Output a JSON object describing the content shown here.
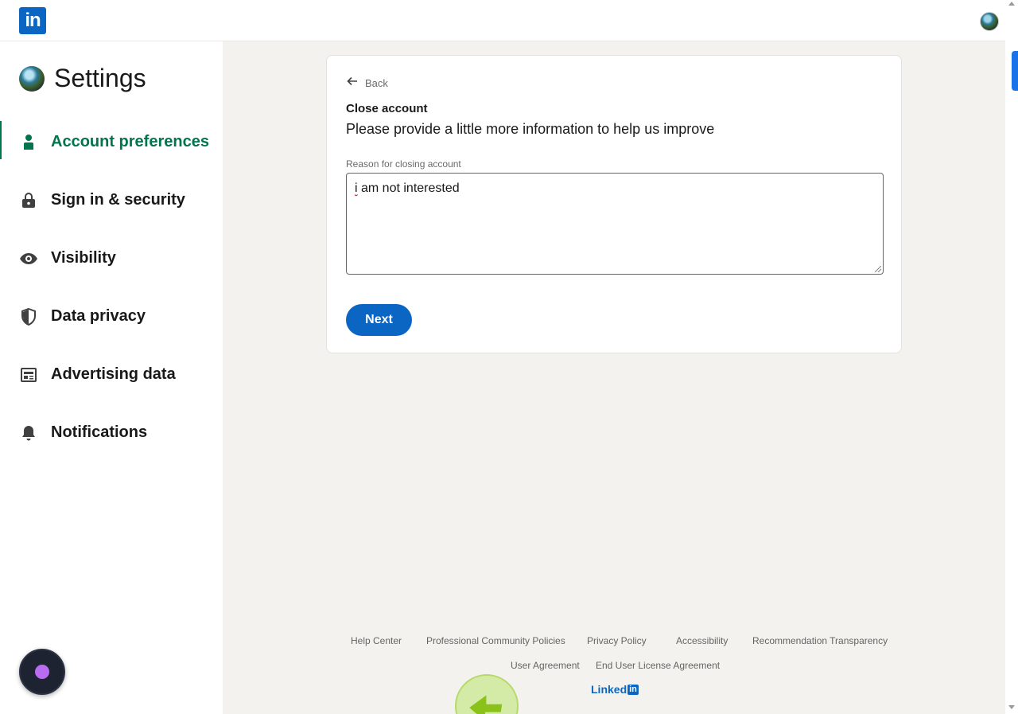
{
  "header": {
    "logo_text": "in",
    "profile_icon": "avatar-icon"
  },
  "sidebar": {
    "title": "Settings",
    "items": [
      {
        "label": "Account preferences",
        "icon": "person-icon",
        "active": true
      },
      {
        "label": "Sign in & security",
        "icon": "lock-icon"
      },
      {
        "label": "Visibility",
        "icon": "eye-icon"
      },
      {
        "label": "Data privacy",
        "icon": "shield-icon"
      },
      {
        "label": "Advertising data",
        "icon": "newspaper-icon"
      },
      {
        "label": "Notifications",
        "icon": "bell-icon"
      }
    ]
  },
  "card": {
    "back_label": "Back",
    "heading": "Close account",
    "subheading": "Please provide a little more information to help us improve",
    "field_label": "Reason for closing account",
    "field_value_first": "i",
    "field_value_rest": " am not interested",
    "next_label": "Next"
  },
  "footer": {
    "links_row1": [
      "Help Center",
      "Professional Community Policies",
      "Privacy Policy",
      "Accessibility",
      "Recommendation Transparency"
    ],
    "links_row2": [
      "User Agreement",
      "End User License Agreement"
    ],
    "brand_text": "Linked",
    "brand_box": "in"
  },
  "colors": {
    "brand_blue": "#0a66c2",
    "active_green": "#01754f",
    "background": "#f4f2ee"
  }
}
